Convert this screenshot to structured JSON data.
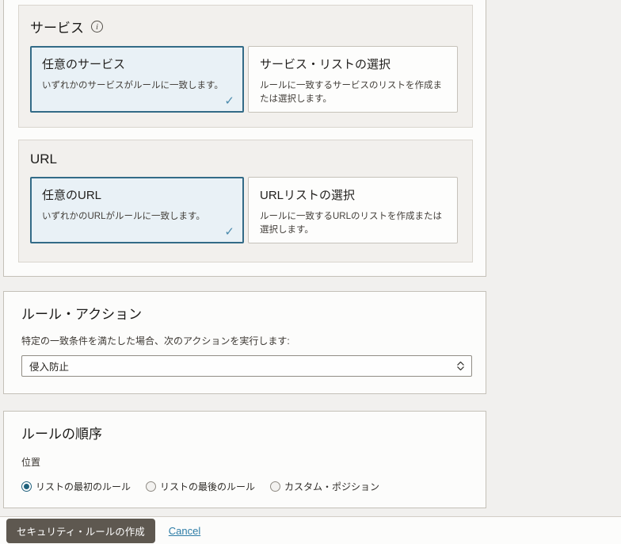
{
  "icons": {
    "info": "i",
    "check": "✓"
  },
  "sections": {
    "service": {
      "title": "サービス",
      "cards": [
        {
          "title": "任意のサービス",
          "description": "いずれかのサービスがルールに一致します。",
          "selected": true
        },
        {
          "title": "サービス・リストの選択",
          "description": "ルールに一致するサービスのリストを作成または選択します。",
          "selected": false
        }
      ]
    },
    "url": {
      "title": "URL",
      "cards": [
        {
          "title": "任意のURL",
          "description": "いずれかのURLがルールに一致します。",
          "selected": true
        },
        {
          "title": "URLリストの選択",
          "description": "ルールに一致するURLのリストを作成または選択します。",
          "selected": false
        }
      ]
    },
    "rule_action": {
      "title": "ルール・アクション",
      "description": "特定の一致条件を満たした場合、次のアクションを実行します:",
      "select_value": "侵入防止"
    },
    "rule_order": {
      "title": "ルールの順序",
      "position_label": "位置",
      "options": [
        {
          "label": "リストの最初のルール",
          "selected": true
        },
        {
          "label": "リストの最後のルール",
          "selected": false
        },
        {
          "label": "カスタム・ポジション",
          "selected": false
        }
      ]
    }
  },
  "footer": {
    "submit_label": "セキュリティ・ルールの作成",
    "cancel_label": "Cancel"
  },
  "colors": {
    "page_bg": "#f1f0ee",
    "panel_bg": "#fcfcfb",
    "selected_card_bg": "#e9f1f6",
    "selected_card_border": "#336b87",
    "radio_selected": "#20617c",
    "button_bg": "#5e5850",
    "link": "#2d7ca6"
  }
}
